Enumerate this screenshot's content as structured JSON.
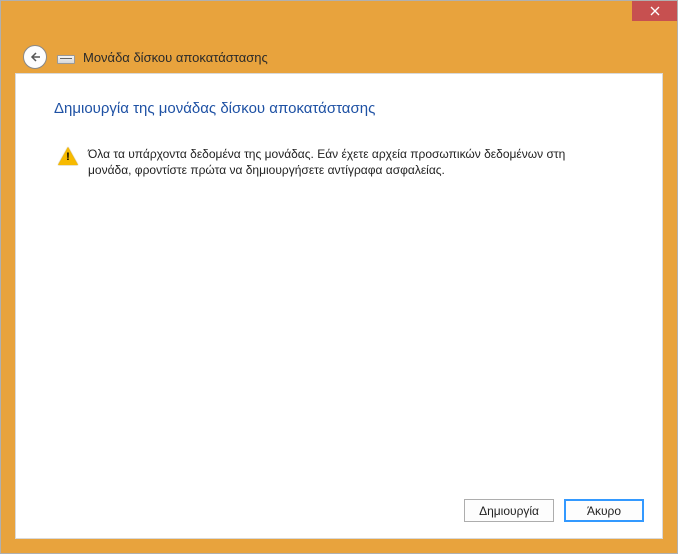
{
  "window": {
    "title": "Μονάδα δίσκου αποκατάστασης"
  },
  "page": {
    "heading": "Δημιουργία της μονάδας δίσκου αποκατάστασης",
    "warning_text": "Όλα τα υπάρχοντα δεδομένα της μονάδας. Εάν έχετε αρχεία προσωπικών δεδομένων στη μονάδα, φροντίστε πρώτα να δημιουργήσετε αντίγραφα ασφαλείας."
  },
  "buttons": {
    "create": "Δημιουργία",
    "cancel": "Άκυρο"
  }
}
